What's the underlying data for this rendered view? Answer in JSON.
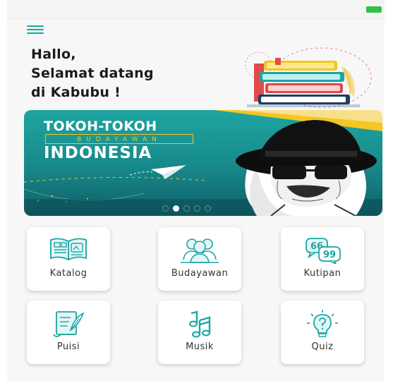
{
  "greeting": {
    "line1": "Hallo,",
    "line2": "Selamat datang",
    "line3": "di Kabubu !"
  },
  "banner": {
    "title_top": "TOKOH-TOKOH",
    "title_mid": "BUDAYAWAN",
    "title_bottom": "INDONESIA",
    "slide_count": 5,
    "active_slide": 2
  },
  "menu": [
    {
      "label": "Katalog",
      "icon": "book-catalog-icon"
    },
    {
      "label": "Budayawan",
      "icon": "people-group-icon"
    },
    {
      "label": "Kutipan",
      "icon": "quote-bubbles-icon"
    },
    {
      "label": "Puisi",
      "icon": "scroll-quill-icon"
    },
    {
      "label": "Musik",
      "icon": "music-note-icon"
    },
    {
      "label": "Quiz",
      "icon": "lightbulb-question-icon"
    }
  ],
  "colors": {
    "accent": "#1aa6a6",
    "banner": "#17888a",
    "highlight": "#f3c623"
  }
}
